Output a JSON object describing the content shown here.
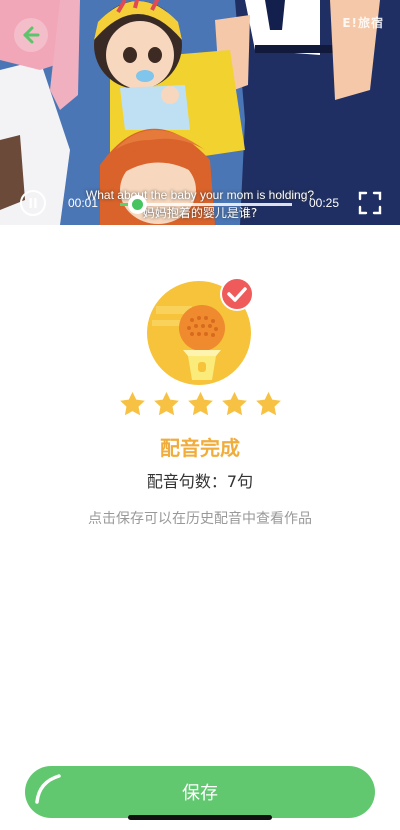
{
  "video": {
    "watermark": "E!旅宿",
    "subtitle_en": "What about the baby your mom is holding?",
    "subtitle_zh": "妈妈抱着的婴儿是谁?",
    "current_time": "00:01",
    "duration": "00:25",
    "progress_fraction": 0.1
  },
  "result": {
    "stars_filled": 5,
    "stars_total": 5,
    "title": "配音完成",
    "count_label": "配音句数：",
    "count_value": "7句",
    "hint": "点击保存可以在历史配音中查看作品"
  },
  "footer": {
    "save_label": "保存"
  },
  "colors": {
    "accent_green": "#61c870",
    "title_orange": "#f0ad3c",
    "star_yellow": "#f7c244",
    "badge_yellow": "#f6c33b",
    "check_red": "#ef5a5a"
  }
}
